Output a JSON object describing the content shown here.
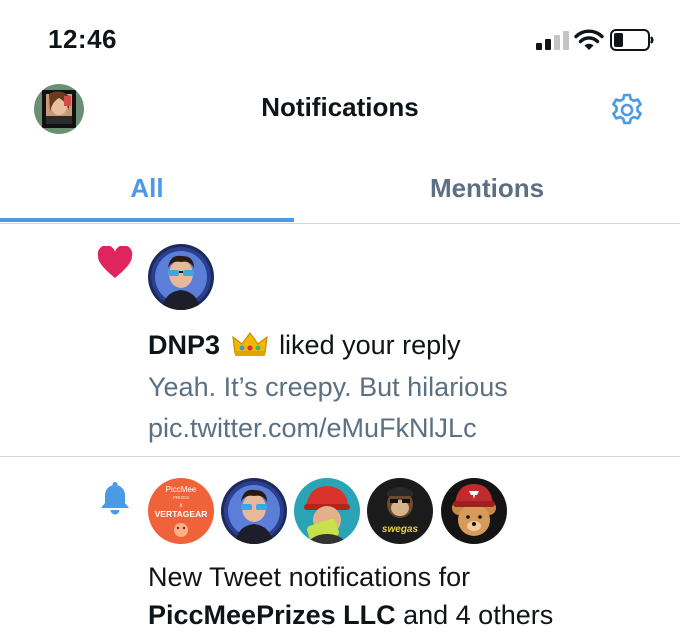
{
  "status_bar": {
    "time": "12:46"
  },
  "header": {
    "title": "Notifications",
    "settings_icon": "gear-icon"
  },
  "tabs": [
    {
      "label": "All",
      "active": true
    },
    {
      "label": "Mentions",
      "active": false
    }
  ],
  "colors": {
    "accent": "#4a9ae6",
    "like": "#e0245e",
    "secondary_text": "#5b7083",
    "divider": "#d4d9dd"
  },
  "notifications": [
    {
      "type": "like",
      "icon": "heart-icon",
      "user": "DNP3",
      "badge_icon": "crown-icon",
      "action": "liked your reply",
      "preview_line1": "Yeah. It’s creepy. But hilarious",
      "preview_line2": "pic.twitter.com/eMuFkNlJLc"
    },
    {
      "type": "tweet_notification",
      "icon": "bell-icon",
      "line1": "New Tweet notifications for",
      "user": "PiccMeePrizes LLC",
      "suffix": " and 4 others",
      "avatar_labels": {
        "piccmee_top": "PiccMee",
        "piccmee_sub": "PRIZES",
        "piccmee_x": "x",
        "piccmee_brand": "VERTAGEAR",
        "swagas_text": "swegas"
      }
    }
  ]
}
